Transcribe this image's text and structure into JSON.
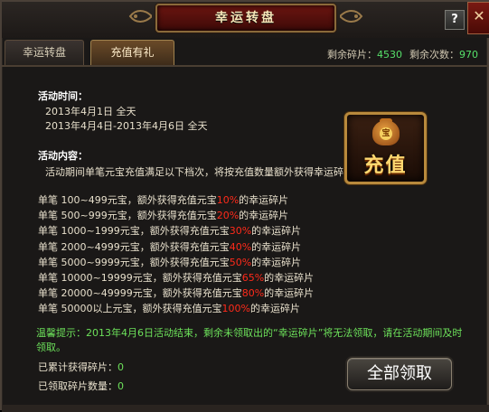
{
  "window": {
    "title": "幸运转盘",
    "help_label": "?",
    "close_label": "✕"
  },
  "tabs": [
    {
      "label": "幸运转盘",
      "active": false
    },
    {
      "label": "充值有礼",
      "active": true
    }
  ],
  "counters": {
    "fragments_label": "剩余碎片：",
    "fragments_value": "4530",
    "times_label": "剩余次数：",
    "times_value": "970"
  },
  "activity_time": {
    "heading": "活动时间：",
    "lines": [
      "2013年4月1日 全天",
      "2013年4月4日-2013年4月6日 全天"
    ]
  },
  "activity_content": {
    "heading": "活动内容：",
    "intro": "活动期间单笔元宝充值满足以下档次，将按充值数量额外获得幸运碎片"
  },
  "tiers": [
    {
      "prefix": "单笔 100~499元宝，额外获得充值元宝",
      "percent": "10%",
      "suffix": "的幸运碎片"
    },
    {
      "prefix": "单笔 500~999元宝，额外获得充值元宝",
      "percent": "20%",
      "suffix": "的幸运碎片"
    },
    {
      "prefix": "单笔 1000~1999元宝，额外获得充值元宝",
      "percent": "30%",
      "suffix": "的幸运碎片"
    },
    {
      "prefix": "单笔 2000~4999元宝，额外获得充值元宝",
      "percent": "40%",
      "suffix": "的幸运碎片"
    },
    {
      "prefix": "单笔 5000~9999元宝，额外获得充值元宝",
      "percent": "50%",
      "suffix": "的幸运碎片"
    },
    {
      "prefix": "单笔 10000~19999元宝，额外获得充值元宝",
      "percent": "65%",
      "suffix": "的幸运碎片"
    },
    {
      "prefix": "单笔 20000~49999元宝，额外获得充值元宝",
      "percent": "80%",
      "suffix": "的幸运碎片"
    },
    {
      "prefix": "单笔 50000以上元宝，额外获得充值元宝",
      "percent": "100%",
      "suffix": "的幸运碎片"
    }
  ],
  "notice": {
    "line1": "温馨提示：2013年4月6日活动结束，剩余未领取出的“幸运碎片”将无法领取，请在活动期间及时",
    "line2": "领取。"
  },
  "stats": {
    "accumulated_label": "已累计获得碎片：",
    "accumulated_value": "0",
    "claimed_label": "已领取碎片数量：",
    "claimed_value": "0"
  },
  "recharge": {
    "bag_glyph": "宝",
    "label": "充值"
  },
  "claim_button": {
    "label": "全部领取"
  },
  "colors": {
    "highlight_red": "#ff2a1a",
    "notice_green": "#6ce05a",
    "counter_green": "#56e06a"
  }
}
